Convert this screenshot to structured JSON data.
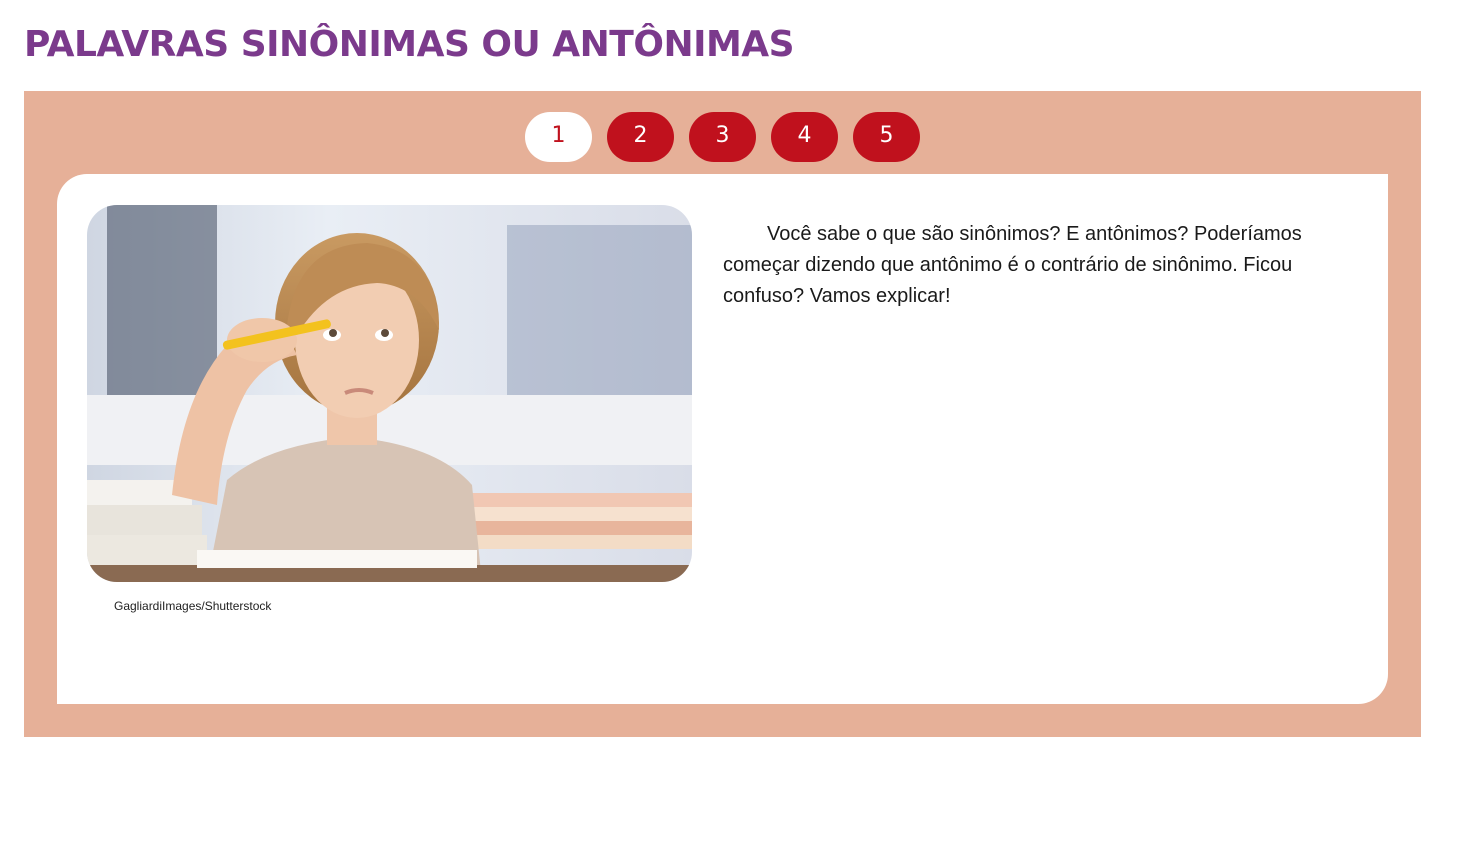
{
  "page": {
    "title": "PALAVRAS SINÔNIMAS OU ANTÔNIMAS"
  },
  "pager": {
    "active": "1",
    "buttons": [
      "1",
      "2",
      "3",
      "4",
      "5"
    ]
  },
  "content": {
    "image_credit": "GagliardiImages/Shutterstock",
    "intro_text": "Você sabe o que são sinônimos? E antônimos? Poderíamos começar dizendo que antônimo é o contrário de sinônimo. Ficou confuso? Vamos explicar!"
  },
  "colors": {
    "title": "#7b3a8c",
    "panel": "#e6b098",
    "pager_button": "#c0111d",
    "pager_active_bg": "#ffffff"
  }
}
